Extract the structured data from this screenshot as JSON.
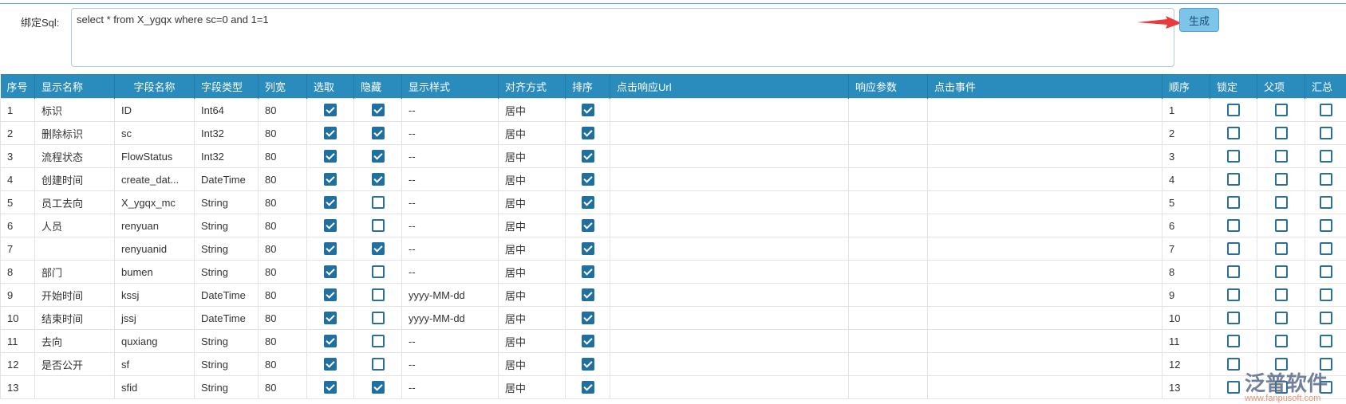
{
  "sql": {
    "label": "绑定Sql:",
    "value": "select * from X_ygqx where sc=0 and 1=1",
    "button": "生成"
  },
  "headers": [
    "序号",
    "显示名称",
    "字段名称",
    "字段类型",
    "列宽",
    "选取",
    "隐藏",
    "显示样式",
    "对齐方式",
    "排序",
    "点击响应Url",
    "响应参数",
    "点击事件",
    "顺序",
    "锁定",
    "父项",
    "汇总"
  ],
  "rows": [
    {
      "no": "1",
      "name": "标识",
      "field": "ID",
      "type": "Int64",
      "width": "80",
      "sel": true,
      "hide": true,
      "style": "--",
      "align": "居中",
      "sort": true,
      "order": "1"
    },
    {
      "no": "2",
      "name": "删除标识",
      "field": "sc",
      "type": "Int32",
      "width": "80",
      "sel": true,
      "hide": true,
      "style": "--",
      "align": "居中",
      "sort": true,
      "order": "2"
    },
    {
      "no": "3",
      "name": "流程状态",
      "field": "FlowStatus",
      "type": "Int32",
      "width": "80",
      "sel": true,
      "hide": true,
      "style": "--",
      "align": "居中",
      "sort": true,
      "order": "3"
    },
    {
      "no": "4",
      "name": "创建时间",
      "field": "create_dat...",
      "type": "DateTime",
      "width": "80",
      "sel": true,
      "hide": true,
      "style": "--",
      "align": "居中",
      "sort": true,
      "order": "4"
    },
    {
      "no": "5",
      "name": "员工去向",
      "field": "X_ygqx_mc",
      "type": "String",
      "width": "80",
      "sel": true,
      "hide": false,
      "style": "--",
      "align": "居中",
      "sort": true,
      "order": "5"
    },
    {
      "no": "6",
      "name": "人员",
      "field": "renyuan",
      "type": "String",
      "width": "80",
      "sel": true,
      "hide": false,
      "style": "--",
      "align": "居中",
      "sort": true,
      "order": "6"
    },
    {
      "no": "7",
      "name": "",
      "field": "renyuanid",
      "type": "String",
      "width": "80",
      "sel": true,
      "hide": true,
      "style": "--",
      "align": "居中",
      "sort": true,
      "order": "7"
    },
    {
      "no": "8",
      "name": "部门",
      "field": "bumen",
      "type": "String",
      "width": "80",
      "sel": true,
      "hide": false,
      "style": "--",
      "align": "居中",
      "sort": true,
      "order": "8"
    },
    {
      "no": "9",
      "name": "开始时间",
      "field": "kssj",
      "type": "DateTime",
      "width": "80",
      "sel": true,
      "hide": false,
      "style": "yyyy-MM-dd",
      "align": "居中",
      "sort": true,
      "order": "9"
    },
    {
      "no": "10",
      "name": "结束时间",
      "field": "jssj",
      "type": "DateTime",
      "width": "80",
      "sel": true,
      "hide": false,
      "style": "yyyy-MM-dd",
      "align": "居中",
      "sort": true,
      "order": "10"
    },
    {
      "no": "11",
      "name": "去向",
      "field": "quxiang",
      "type": "String",
      "width": "80",
      "sel": true,
      "hide": false,
      "style": "--",
      "align": "居中",
      "sort": true,
      "order": "11"
    },
    {
      "no": "12",
      "name": "是否公开",
      "field": "sf",
      "type": "String",
      "width": "80",
      "sel": true,
      "hide": false,
      "style": "--",
      "align": "居中",
      "sort": true,
      "order": "12"
    },
    {
      "no": "13",
      "name": "",
      "field": "sfid",
      "type": "String",
      "width": "80",
      "sel": true,
      "hide": true,
      "style": "--",
      "align": "居中",
      "sort": true,
      "order": "13"
    }
  ],
  "watermark": {
    "name": "泛普软件",
    "url": "www.fanpusoft.com"
  }
}
